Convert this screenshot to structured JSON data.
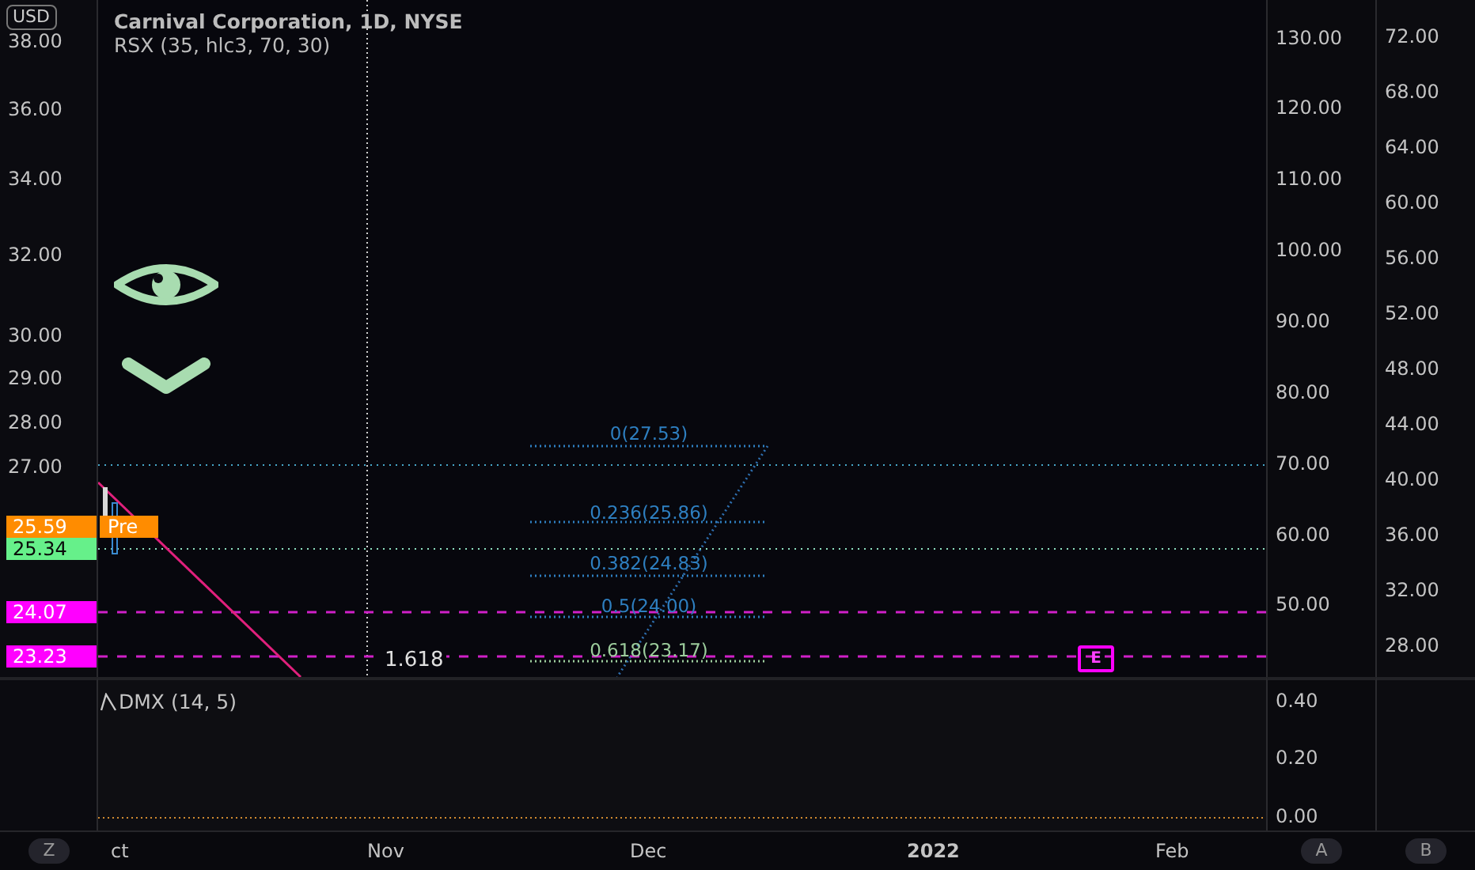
{
  "header": {
    "currency": "USD",
    "title": "Carnival Corporation, 1D, NYSE",
    "indicator": "RSX (35, hlc3, 70, 30)"
  },
  "left_axis": [
    "38.00",
    "36.00",
    "34.00",
    "32.00",
    "30.00",
    "29.00",
    "28.00",
    "27.00"
  ],
  "price_tags": [
    {
      "label": "25.59",
      "color": "#ff8c00"
    },
    {
      "label": "25.34",
      "color": "#66f08a"
    },
    {
      "label": "24.07",
      "color": "#ff00ff"
    },
    {
      "label": "23.23",
      "color": "#ff00ff"
    }
  ],
  "pre_tag": "Pre",
  "fib_levels": [
    {
      "label": "0(27.53)",
      "color": "#2e7fc0"
    },
    {
      "label": "0.236(25.86)",
      "color": "#2e7fc0"
    },
    {
      "label": "0.382(24.83)",
      "color": "#2e7fc0"
    },
    {
      "label": "0.5(24.00)",
      "color": "#2e7fc0"
    },
    {
      "label": "0.618(23.17)",
      "color": "#9ccc9c"
    }
  ],
  "projection_label": "1.618",
  "event_badge": "E",
  "axis_a": [
    "130.00",
    "120.00",
    "110.00",
    "100.00",
    "90.00",
    "80.00",
    "70.00",
    "60.00",
    "50.00"
  ],
  "axis_b": [
    "72.00",
    "68.00",
    "64.00",
    "60.00",
    "56.00",
    "52.00",
    "48.00",
    "44.00",
    "40.00",
    "36.00",
    "32.00",
    "28.00"
  ],
  "lower_pane": {
    "title": "DMX (14, 5)",
    "axis": [
      "0.40",
      "0.20",
      "0.00"
    ]
  },
  "time_axis": [
    {
      "label": "ct",
      "kind": "month"
    },
    {
      "label": "Nov",
      "kind": "month"
    },
    {
      "label": "Dec",
      "kind": "month"
    },
    {
      "label": "2022",
      "kind": "year"
    },
    {
      "label": "Feb",
      "kind": "month"
    }
  ],
  "scale_buttons": [
    "Z",
    "A",
    "B"
  ]
}
